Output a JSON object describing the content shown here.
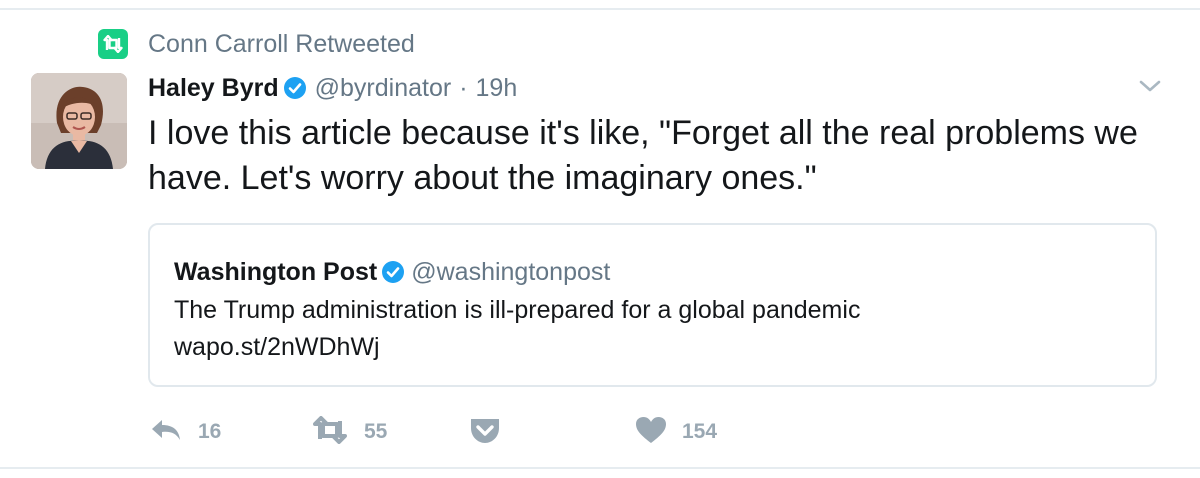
{
  "retweet_context": {
    "label": "Conn Carroll Retweeted",
    "icon": "retweet-icon",
    "icon_color": "#19cf86"
  },
  "tweet": {
    "author_name": "Haley Byrd",
    "author_handle": "@byrdinator",
    "separator": "·",
    "timestamp": "19h",
    "verified": true,
    "verified_color": "#1da1f2",
    "text": "I love this article because it's like, \"Forget all the real problems we have. Let's worry about the imaginary ones.\""
  },
  "quoted_tweet": {
    "author_name": "Washington Post",
    "author_handle": "@washingtonpost",
    "verified": true,
    "text_line1": "The Trump administration is ill-prepared for a global pandemic",
    "text_line2": "wapo.st/2nWDhWj"
  },
  "actions": {
    "reply_count": "16",
    "retweet_count": "55",
    "like_count": "154",
    "icon_color": "#9aa8b3"
  }
}
